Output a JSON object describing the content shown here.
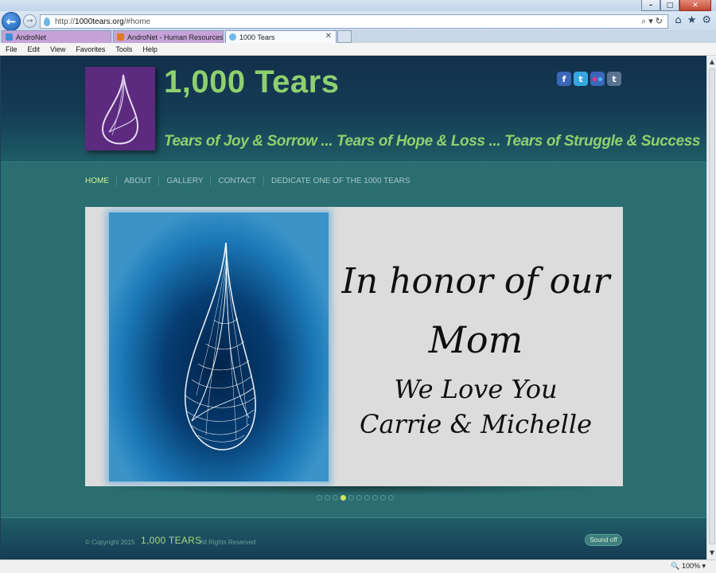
{
  "browser": {
    "url_prefix": "http://",
    "url_domain": "1000tears.org",
    "url_suffix": "/#home",
    "tabs": [
      {
        "label": "AndroNet"
      },
      {
        "label": "AndroNet - Human Resources:..."
      },
      {
        "label": "1000 Tears"
      }
    ],
    "menu": [
      "File",
      "Edit",
      "View",
      "Favorites",
      "Tools",
      "Help"
    ],
    "zoom": "100%"
  },
  "site": {
    "title": "1,000 Tears",
    "tagline": "Tears of Joy & Sorrow ... Tears of Hope & Loss ... Tears of Struggle & Success",
    "nav": [
      "HOME",
      "ABOUT",
      "GALLERY",
      "CONTACT",
      "DEDICATE ONE OF THE 1000 TEARS"
    ],
    "slide": {
      "line1": "In honor of our",
      "line2": "Mom",
      "line3": "We Love You",
      "line4": "Carrie & Michelle"
    },
    "slider": {
      "total": 10,
      "active_index": 3
    },
    "footer": {
      "copyright": "© Copyright 2015",
      "brand": "1,000 TEARS",
      "rights": "All Rights Reserved",
      "sound_button": "Sound off"
    }
  },
  "icons": {
    "social": [
      "facebook-icon",
      "twitter-icon",
      "flickr-icon",
      "tumblr-icon"
    ]
  },
  "colors": {
    "accent_green": "#8fd06e",
    "page_teal": "#2a6e72",
    "header_navy": "#12304b",
    "logo_purple": "#5c2a7e",
    "active_nav": "#d2ef8a"
  }
}
